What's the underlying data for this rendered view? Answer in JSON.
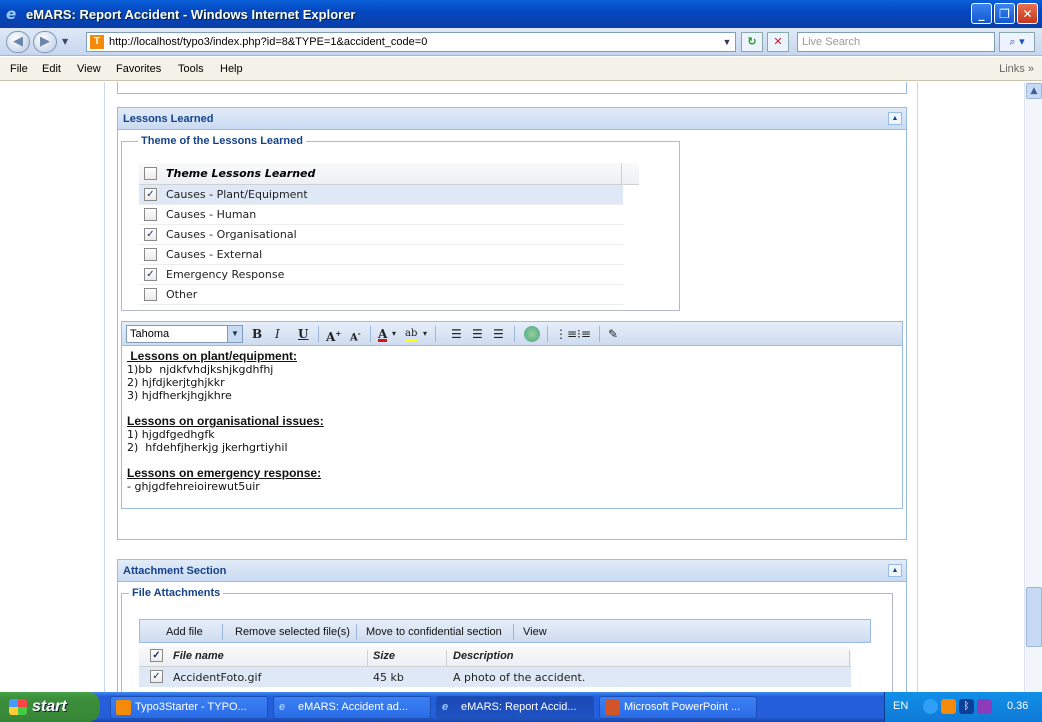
{
  "window": {
    "title": "eMARS: Report Accident - Windows Internet Explorer"
  },
  "address": {
    "url": "http://localhost/typo3/index.php?id=8&TYPE=1&accident_code=0",
    "search_placeholder": "Live Search"
  },
  "menu": {
    "items": [
      "File",
      "Edit",
      "View",
      "Favorites",
      "Tools",
      "Help"
    ],
    "links": "Links"
  },
  "lessons": {
    "panel_title": "Lessons Learned",
    "fieldset_title": "Theme of the Lessons Learned",
    "grid_header": "Theme Lessons Learned",
    "rows": [
      {
        "label": "Causes - Plant/Equipment",
        "checked": true,
        "selected": true
      },
      {
        "label": "Causes - Human",
        "checked": false,
        "selected": false
      },
      {
        "label": "Causes - Organisational",
        "checked": true,
        "selected": false
      },
      {
        "label": "Causes - External",
        "checked": false,
        "selected": false
      },
      {
        "label": "Emergency Response",
        "checked": true,
        "selected": false
      },
      {
        "label": "Other",
        "checked": false,
        "selected": false
      }
    ]
  },
  "editor": {
    "font": "Tahoma",
    "lines": [
      {
        "type": "heading",
        "text": " Lessons on plant/equipment:"
      },
      {
        "type": "text",
        "text": "1)bb  njdkfvhdjkshjkgdhfhj"
      },
      {
        "type": "text",
        "text": "2) hjfdjkerjtghjkkr"
      },
      {
        "type": "text",
        "text": "3) hjdfherkjhgjkhre"
      },
      {
        "type": "gap",
        "text": ""
      },
      {
        "type": "heading",
        "text": "Lessons on organisational issues:"
      },
      {
        "type": "text",
        "text": "1) hjgdfgedhgfk"
      },
      {
        "type": "text",
        "text": "2)  hfdehfjherkjg jkerhgrtiyhil"
      },
      {
        "type": "gap",
        "text": ""
      },
      {
        "type": "heading",
        "text": "Lessons on emergency response:"
      },
      {
        "type": "text",
        "text": "- ghjgdfehreioirewut5uir"
      }
    ]
  },
  "attachments": {
    "panel_title": "Attachment Section",
    "fieldset_title": "File Attachments",
    "toolbar": {
      "add": "Add file",
      "remove": "Remove selected file(s)",
      "move": "Move to confidential section",
      "view": "View"
    },
    "columns": [
      "File name",
      "Size",
      "Description"
    ],
    "rows": [
      {
        "file": "AccidentFoto.gif",
        "size": "45 kb",
        "description": "A photo of the accident.",
        "checked": true
      }
    ]
  },
  "taskbar": {
    "start": "start",
    "tasks": [
      {
        "label": "Typo3Starter - TYPO...",
        "active": false
      },
      {
        "label": "eMARS: Accident ad...",
        "active": false
      },
      {
        "label": "eMARS: Report Accid...",
        "active": true
      },
      {
        "label": "Microsoft PowerPoint ...",
        "active": false
      }
    ],
    "lang": "EN",
    "clock": "0.36"
  }
}
